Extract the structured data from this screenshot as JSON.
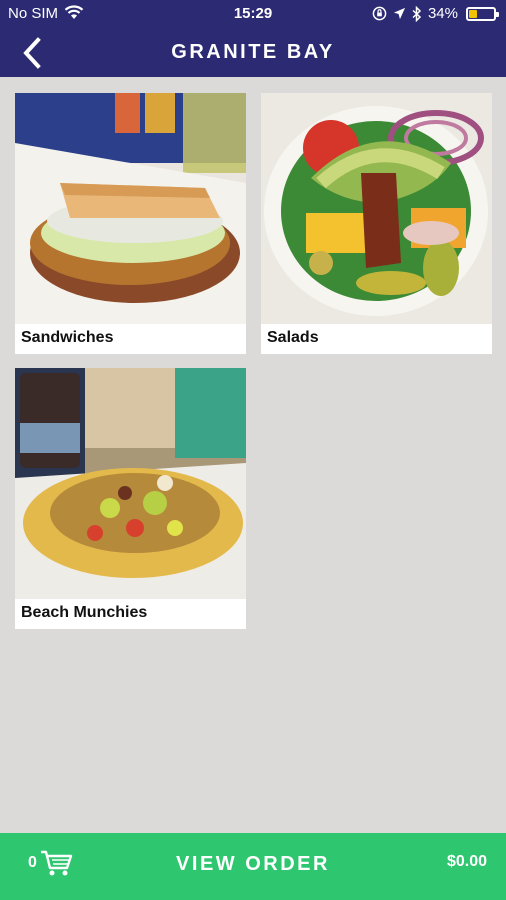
{
  "status_bar": {
    "carrier": "No SIM",
    "time": "15:29",
    "battery": "34%",
    "battery_level": 0.34
  },
  "header": {
    "title": "GRANITE BAY"
  },
  "categories": [
    {
      "label": "Sandwiches",
      "image": "sandwich-photo"
    },
    {
      "label": "Salads",
      "image": "salad-photo"
    },
    {
      "label": "Beach Munchies",
      "image": "nachos-photo"
    }
  ],
  "footer": {
    "cart_count": "0",
    "view_order_label": "VIEW ORDER",
    "total": "$0.00"
  },
  "colors": {
    "header_bg": "#2b2a73",
    "page_bg": "#dcdad8",
    "footer_bg": "#2ec66f",
    "battery_fill": "#f2c300"
  }
}
